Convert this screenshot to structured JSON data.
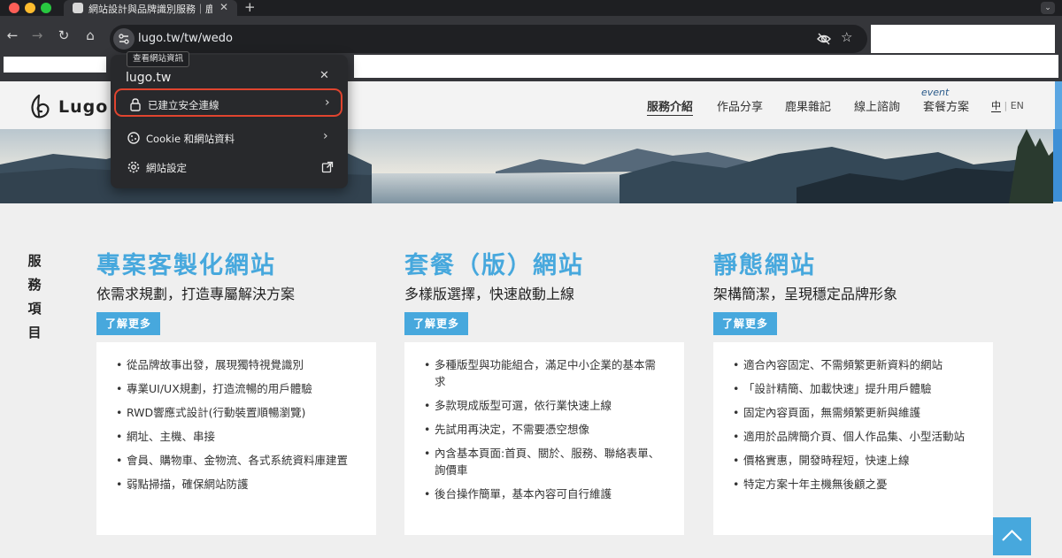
{
  "browser": {
    "tab_title": "網站設計與品牌識別服務｜鹿果",
    "url": "lugo.tw/tw/wedo",
    "tooltip": "查看網站資訊"
  },
  "site_info_popup": {
    "host": "lugo.tw",
    "rows": [
      {
        "label": "已建立安全連線",
        "icon": "lock-icon"
      },
      {
        "label": "Cookie 和網站資料",
        "icon": "cookie-icon"
      },
      {
        "label": "網站設定",
        "icon": "gear-icon"
      }
    ]
  },
  "site": {
    "logo_text": "Lugo",
    "nav": [
      "服務介紹",
      "作品分享",
      "鹿果雜記",
      "線上諮詢",
      "套餐方案"
    ],
    "nav_event_label": "event",
    "lang_zh": "中",
    "lang_sep": "|",
    "lang_en": "EN"
  },
  "section": {
    "vertical_title": [
      "服",
      "務",
      "項",
      "目"
    ],
    "learn_more": "了解更多",
    "columns": [
      {
        "title": "專案客製化網站",
        "subtitle": "依需求規劃，打造專屬解決方案",
        "items": [
          "從品牌故事出發，展現獨特視覺識別",
          "專業UI/UX規劃，打造流暢的用戶體驗",
          "RWD響應式設計(行動裝置順暢瀏覽)",
          "網址、主機、串接",
          "會員、購物車、金物流、各式系統資料庫建置",
          "弱點掃描，確保網站防護"
        ]
      },
      {
        "title": "套餐（版）網站",
        "subtitle": "多樣版選擇，快速啟動上線",
        "items": [
          "多種版型與功能組合，滿足中小企業的基本需求",
          "多款現成版型可選，依行業快速上線",
          "先試用再決定，不需要憑空想像",
          "內含基本頁面:首頁、關於、服務、聯絡表單、詢價車",
          "後台操作簡單，基本內容可自行維護"
        ]
      },
      {
        "title": "靜態網站",
        "subtitle": "架構簡潔，呈現穩定品牌形象",
        "items": [
          "適合內容固定、不需頻繁更新資料的網站",
          "「設計精簡、加載快速」提升用戶體驗",
          "固定內容頁面，無需頻繁更新與維護",
          "適用於品牌簡介頁、個人作品集、小型活動站",
          "價格實惠，開發時程短，快速上線",
          "特定方案十年主機無後顧之憂"
        ]
      }
    ]
  },
  "colors": {
    "accent": "#47a8dd",
    "chrome_dark": "#35363a",
    "highlight_border": "#e0442f"
  }
}
